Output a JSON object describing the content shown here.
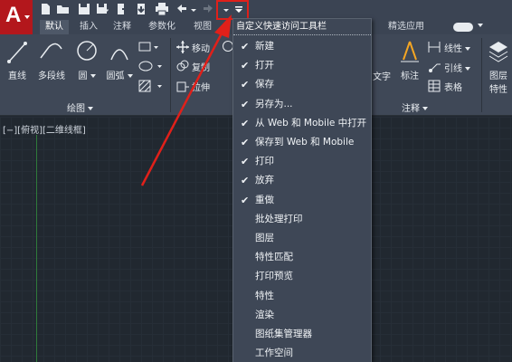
{
  "app": {
    "logo_letter": "A"
  },
  "tabs": [
    {
      "label": "默认",
      "active": true
    },
    {
      "label": "插入"
    },
    {
      "label": "注释"
    },
    {
      "label": "参数化"
    },
    {
      "label": "视图"
    },
    {
      "label": "精选应用"
    }
  ],
  "ribbon": {
    "draw": {
      "line": "直线",
      "polyline": "多段线",
      "circle": "圆",
      "arc": "圆弧",
      "panel_title": "绘图"
    },
    "modify": {
      "move": "移动",
      "copy": "复制",
      "stretch": "拉伸"
    },
    "annotation": {
      "text": "文字",
      "dimension": "标注",
      "linear": "线性",
      "leader": "引线",
      "table": "表格",
      "panel_title": "注释"
    },
    "layers": {
      "layer_props_1": "图层",
      "layer_props_2": "特性"
    }
  },
  "viewport": {
    "label": "[−][俯视][二维线框]"
  },
  "menu": {
    "title": "自定义快速访问工具栏",
    "items": [
      {
        "label": "新建",
        "checked": true
      },
      {
        "label": "打开",
        "checked": true
      },
      {
        "label": "保存",
        "checked": true
      },
      {
        "label": "另存为...",
        "checked": true
      },
      {
        "label": "从 Web 和 Mobile 中打开",
        "checked": true
      },
      {
        "label": "保存到 Web 和 Mobile",
        "checked": true
      },
      {
        "label": "打印",
        "checked": true
      },
      {
        "label": "放弃",
        "checked": true
      },
      {
        "label": "重做",
        "checked": true
      },
      {
        "label": "批处理打印",
        "checked": false
      },
      {
        "label": "图层",
        "checked": false
      },
      {
        "label": "特性匹配",
        "checked": false
      },
      {
        "label": "打印预览",
        "checked": false
      },
      {
        "label": "特性",
        "checked": false
      },
      {
        "label": "渲染",
        "checked": false
      },
      {
        "label": "图纸集管理器",
        "checked": false
      },
      {
        "label": "工作空间",
        "checked": false
      }
    ]
  },
  "colors": {
    "accent_red": "#e0201a",
    "logo_red": "#b3171c",
    "menu_bg": "#3e4756",
    "viewport_bg": "#212830"
  }
}
